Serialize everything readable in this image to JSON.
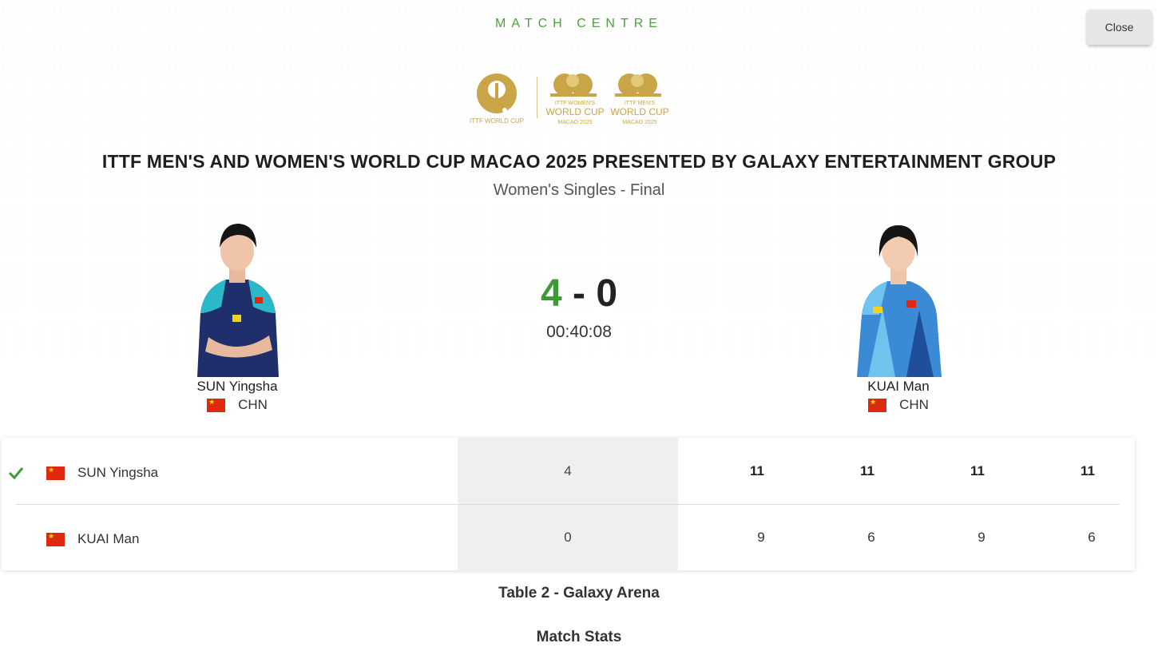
{
  "header": {
    "label": "MATCH CENTRE",
    "close_label": "Close"
  },
  "logos": {
    "logo1_text": "ITTF WORLD CUP",
    "logo2_line1": "ITTF WOMEN'S",
    "logo2_line2": "WORLD CUP",
    "logo2_line3": "MACAO 2025",
    "logo3_line1": "ITTF MEN'S",
    "logo3_line2": "WORLD CUP",
    "logo3_line3": "MACAO 2025",
    "color": "#c9a548"
  },
  "event": {
    "title": "ITTF MEN'S AND WOMEN'S WORLD CUP MACAO 2025 PRESENTED BY GALAXY ENTERTAINMENT GROUP",
    "subtitle": "Women's Singles - Final"
  },
  "players": {
    "left": {
      "name": "SUN Yingsha",
      "country": "CHN"
    },
    "right": {
      "name": "KUAI Man",
      "country": "CHN"
    }
  },
  "score": {
    "left": "4",
    "separator": " - ",
    "right": "0",
    "duration": "00:40:08"
  },
  "table": {
    "rows": [
      {
        "name": "SUN Yingsha",
        "winner": true,
        "games": "4",
        "sets": [
          "11",
          "11",
          "11",
          "11"
        ]
      },
      {
        "name": "KUAI Man",
        "winner": false,
        "games": "0",
        "sets": [
          "9",
          "6",
          "9",
          "6"
        ]
      }
    ]
  },
  "venue": "Table 2 - Galaxy Arena",
  "stats_label": "Match Stats",
  "colors": {
    "accent_green": "#4aa23a",
    "score_green": "#3d9b35",
    "flag_red": "#de2910",
    "gold": "#c9a548"
  }
}
